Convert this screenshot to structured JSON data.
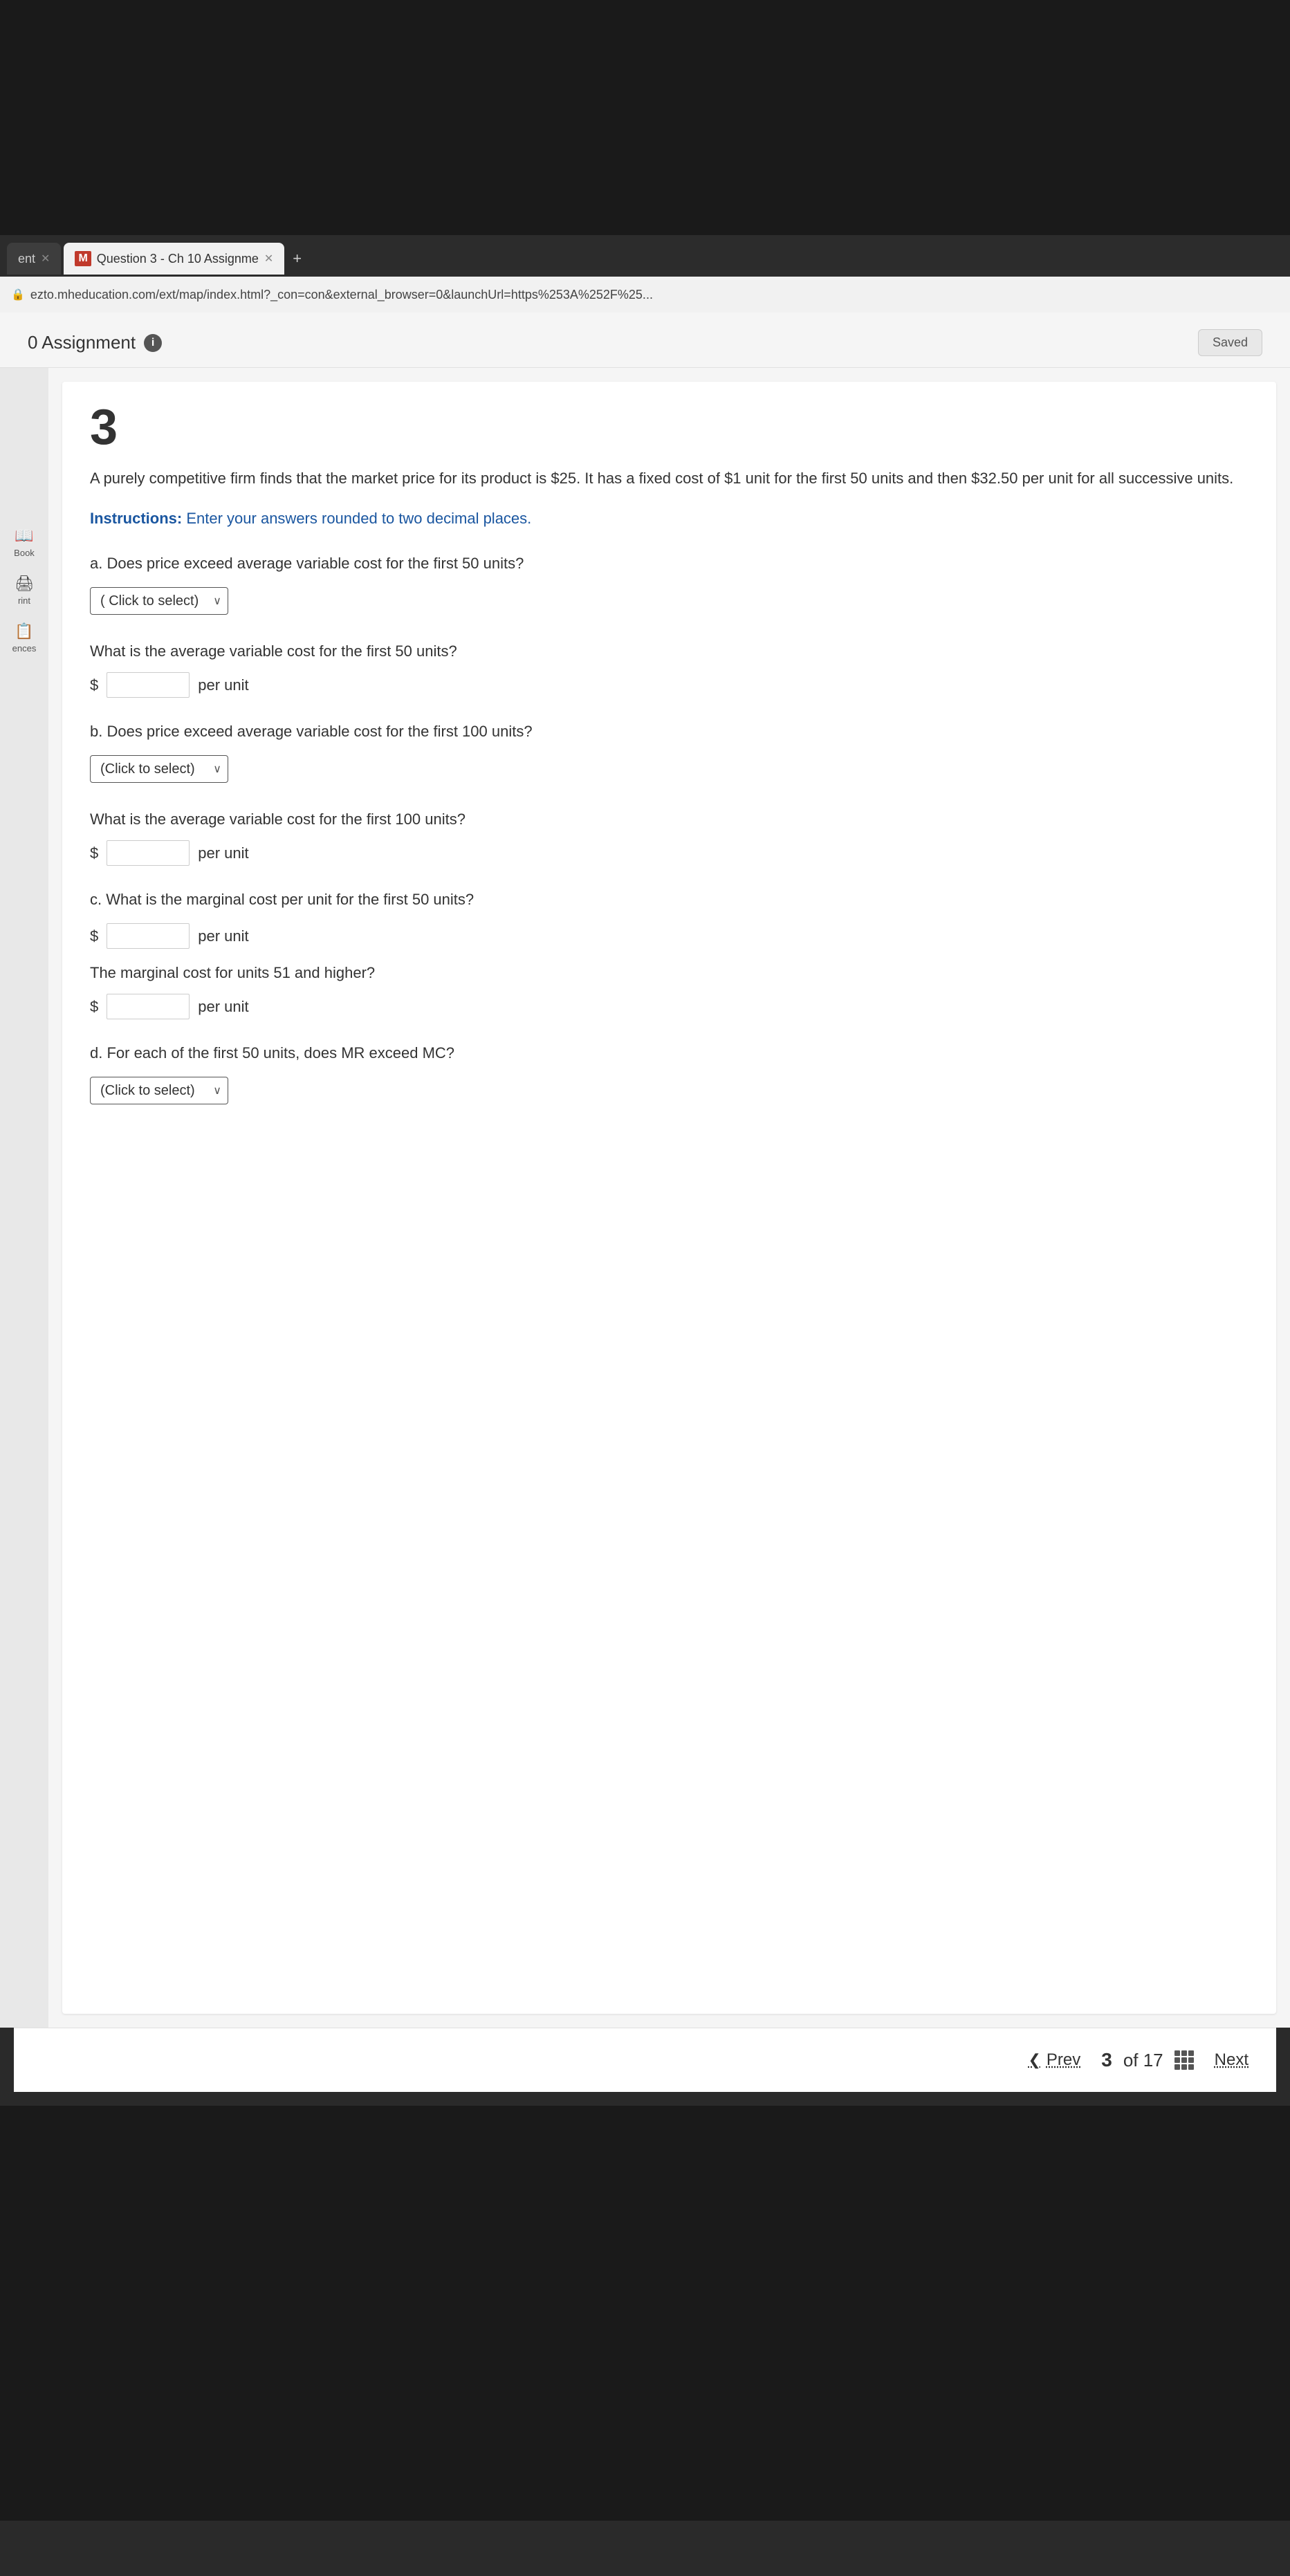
{
  "browser": {
    "tabs": [
      {
        "id": "tab1",
        "label": "ent",
        "active": false,
        "hasClose": true
      },
      {
        "id": "tab2",
        "logo": "M",
        "label": "Question 3 - Ch 10 Assignme",
        "active": true,
        "hasClose": true
      }
    ],
    "tab_plus": "+",
    "address_bar": "ezto.mheducation.com/ext/map/index.html?_con=con&external_browser=0&launchUrl=https%253A%252F%25..."
  },
  "app": {
    "title": "0 Assignment",
    "saved_label": "Saved",
    "info_icon": "i"
  },
  "sidebar": {
    "items": [
      {
        "id": "book",
        "icon": "📖",
        "label": "Book"
      },
      {
        "id": "print",
        "icon": "🖨",
        "label": "rint"
      },
      {
        "id": "references",
        "icon": "📋",
        "label": "ences"
      }
    ]
  },
  "question": {
    "number": "3",
    "text": "A purely competitive firm finds that the market price for its product is $25. It has a fixed cost of $1 unit for the first 50 units and then $32.50 per unit for all successive units.",
    "instructions_label": "Instructions:",
    "instructions_body": " Enter your answers rounded to two decimal places.",
    "sub_questions": [
      {
        "id": "a",
        "label": "a. Does price exceed average variable cost for the first 50 units?",
        "has_select": true,
        "select_placeholder": "(Click to select)",
        "follow_up_text": "What is the average variable cost for the first 50 units?",
        "has_input": true,
        "input_value": "",
        "per_unit": "per unit"
      },
      {
        "id": "b",
        "label": "b. Does price exceed average variable cost for the first 100 units?",
        "has_select": true,
        "select_placeholder": "(Click to select)",
        "follow_up_text": "What is the average variable cost for the first 100 units?",
        "has_input": true,
        "input_value": "",
        "per_unit": "per unit"
      },
      {
        "id": "c",
        "label": "c. What is the marginal cost per unit for the first 50 units?",
        "has_select": false,
        "has_input": true,
        "input_value": "",
        "per_unit": "per unit",
        "follow_up_text": "The marginal cost for units 51 and higher?",
        "has_second_input": true,
        "second_input_value": "",
        "second_per_unit": "per unit"
      },
      {
        "id": "d",
        "label": "d. For each of the first 50 units, does MR exceed MC?",
        "has_select": true,
        "select_placeholder": "(Click to select)",
        "has_input": false
      }
    ]
  },
  "navigation": {
    "prev_label": "Prev",
    "next_label": "Next",
    "current_page": "3",
    "total_pages": "of 17",
    "chevron_left": "❮"
  }
}
